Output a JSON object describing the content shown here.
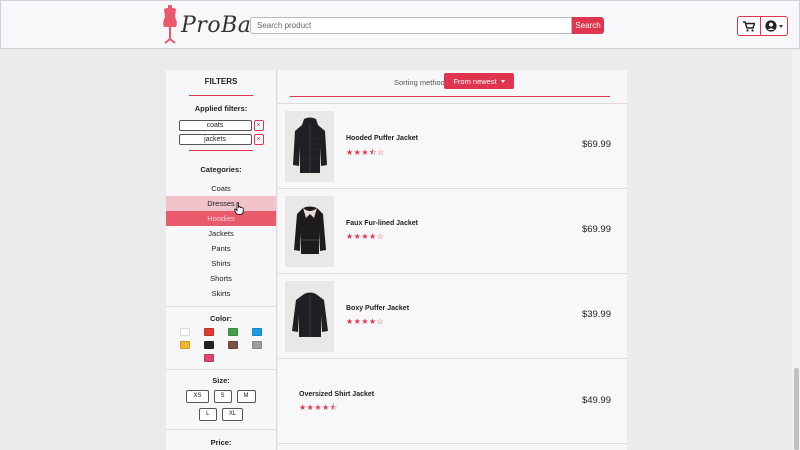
{
  "brand": {
    "name": "ProBaz",
    "accent": "#e0354f"
  },
  "search": {
    "placeholder": "Search product",
    "button": "Search"
  },
  "header_icons": {
    "cart": "cart-icon",
    "account": "user-circle-icon"
  },
  "filters": {
    "title": "FILTERS",
    "applied_title": "Applied filters:",
    "applied": [
      {
        "label": "coats",
        "remove": "×"
      },
      {
        "label": "jackets",
        "remove": "×"
      }
    ],
    "categories_title": "Categories:",
    "categories": [
      "Coats",
      "Dresses",
      "Hoodies",
      "Jackets",
      "Pants",
      "Shirts",
      "Shorts",
      "Skirts"
    ],
    "color_title": "Color:",
    "colors": [
      "#ffffff",
      "#e53935",
      "#43a047",
      "#1e9be6",
      "#f5b32e",
      "#222222",
      "#7b5246",
      "#9e9e9e",
      "#e0456d"
    ],
    "size_title": "Size:",
    "sizes": [
      "XS",
      "S",
      "M",
      "L",
      "XL"
    ],
    "price_title": "Price:"
  },
  "sorting": {
    "label": "Sorting method:",
    "value": "From newest"
  },
  "products": [
    {
      "name": "Hooded Puffer Jacket",
      "stars": "★★★⯪☆",
      "price": "$69.99"
    },
    {
      "name": "Faux Fur-lined Jacket",
      "stars": "★★★★☆",
      "price": "$69.99"
    },
    {
      "name": "Boxy Puffer Jacket",
      "stars": "★★★★☆",
      "price": "$39.99"
    },
    {
      "name": "Oversized Shirt Jacket",
      "stars": "★★★★⯪",
      "price": "$49.99"
    }
  ]
}
